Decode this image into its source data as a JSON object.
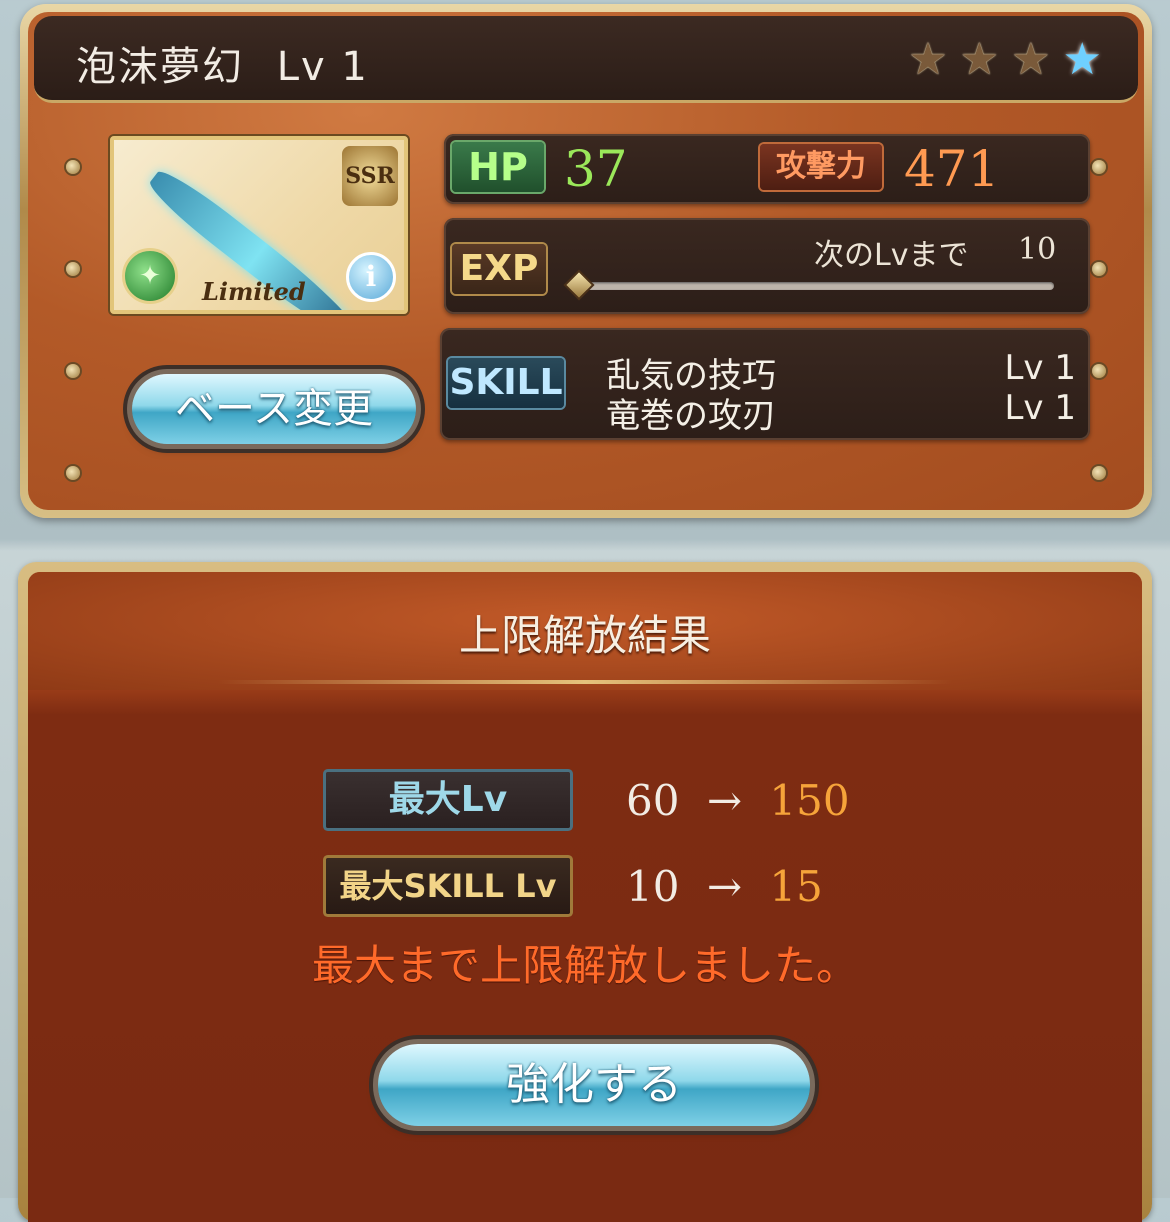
{
  "weapon": {
    "name": "泡沫夢幻",
    "level_text": "Lv 1",
    "stars": [
      {
        "icon": "star-gold-icon",
        "glyph": "★"
      },
      {
        "icon": "star-gold-icon",
        "glyph": "★"
      },
      {
        "icon": "star-gold-icon",
        "glyph": "★"
      },
      {
        "icon": "star-blue-icon",
        "glyph": "★"
      }
    ],
    "rarity": "SSR",
    "element_icon": "wind-element-icon",
    "element_glyph": "✦",
    "limited_label": "Limited",
    "info_glyph": "i"
  },
  "actions": {
    "base_change_label": "ベース変更",
    "enhance_label": "強化する"
  },
  "stats": {
    "hp_label": "HP",
    "hp_value": "37",
    "atk_label": "攻撃力",
    "atk_value": "471",
    "exp_label": "EXP",
    "exp_next_label": "次のLvまで",
    "exp_next_value": "10",
    "exp_progress": 0
  },
  "skills": {
    "label": "SKILL",
    "items": [
      {
        "name": "乱気の技巧",
        "level": "Lv 1"
      },
      {
        "name": "竜巻の攻刃",
        "level": "Lv 1"
      }
    ]
  },
  "uncap_result": {
    "title": "上限解放結果",
    "max_lv_label": "最大Lv",
    "max_lv_from": "60",
    "max_lv_to": "150",
    "max_skill_lv_label": "最大SKILL Lv",
    "max_skill_lv_from": "10",
    "max_skill_lv_to": "15",
    "arrow": "→",
    "message": "最大まで上限解放しました。"
  },
  "colors": {
    "accent_orange": "#f6a43a",
    "message_red": "#ff6a2a",
    "hp_green": "#9be85a",
    "button_blue": "#8fd8ea"
  }
}
